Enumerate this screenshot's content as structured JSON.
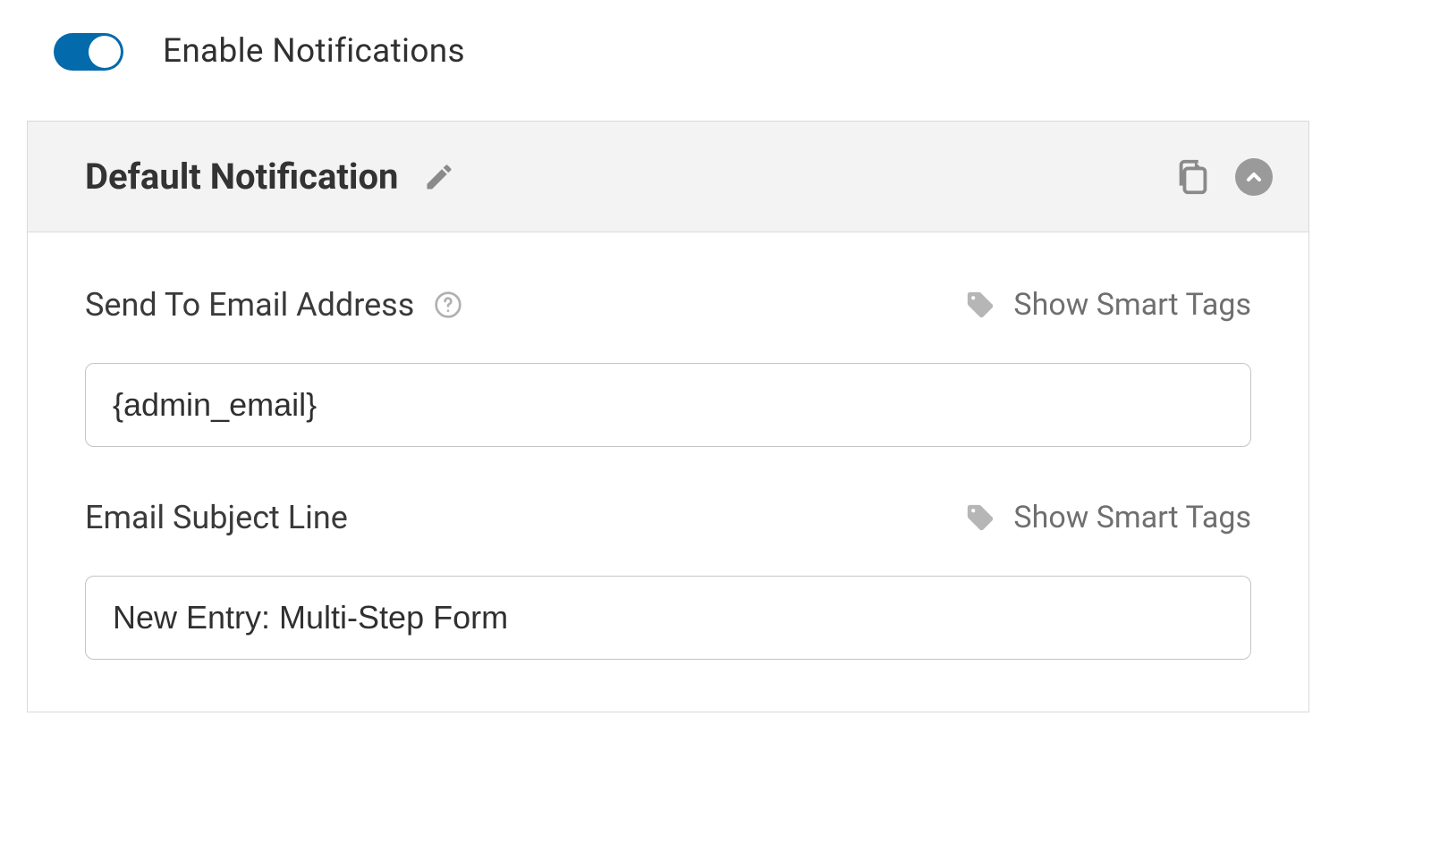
{
  "toggle": {
    "label": "Enable Notifications",
    "checked": true
  },
  "panel": {
    "title": "Default Notification",
    "smart_tags_label": "Show Smart Tags"
  },
  "fields": {
    "send_to": {
      "label": "Send To Email Address",
      "value": "{admin_email}"
    },
    "subject": {
      "label": "Email Subject Line",
      "value": "New Entry: Multi-Step Form"
    }
  }
}
